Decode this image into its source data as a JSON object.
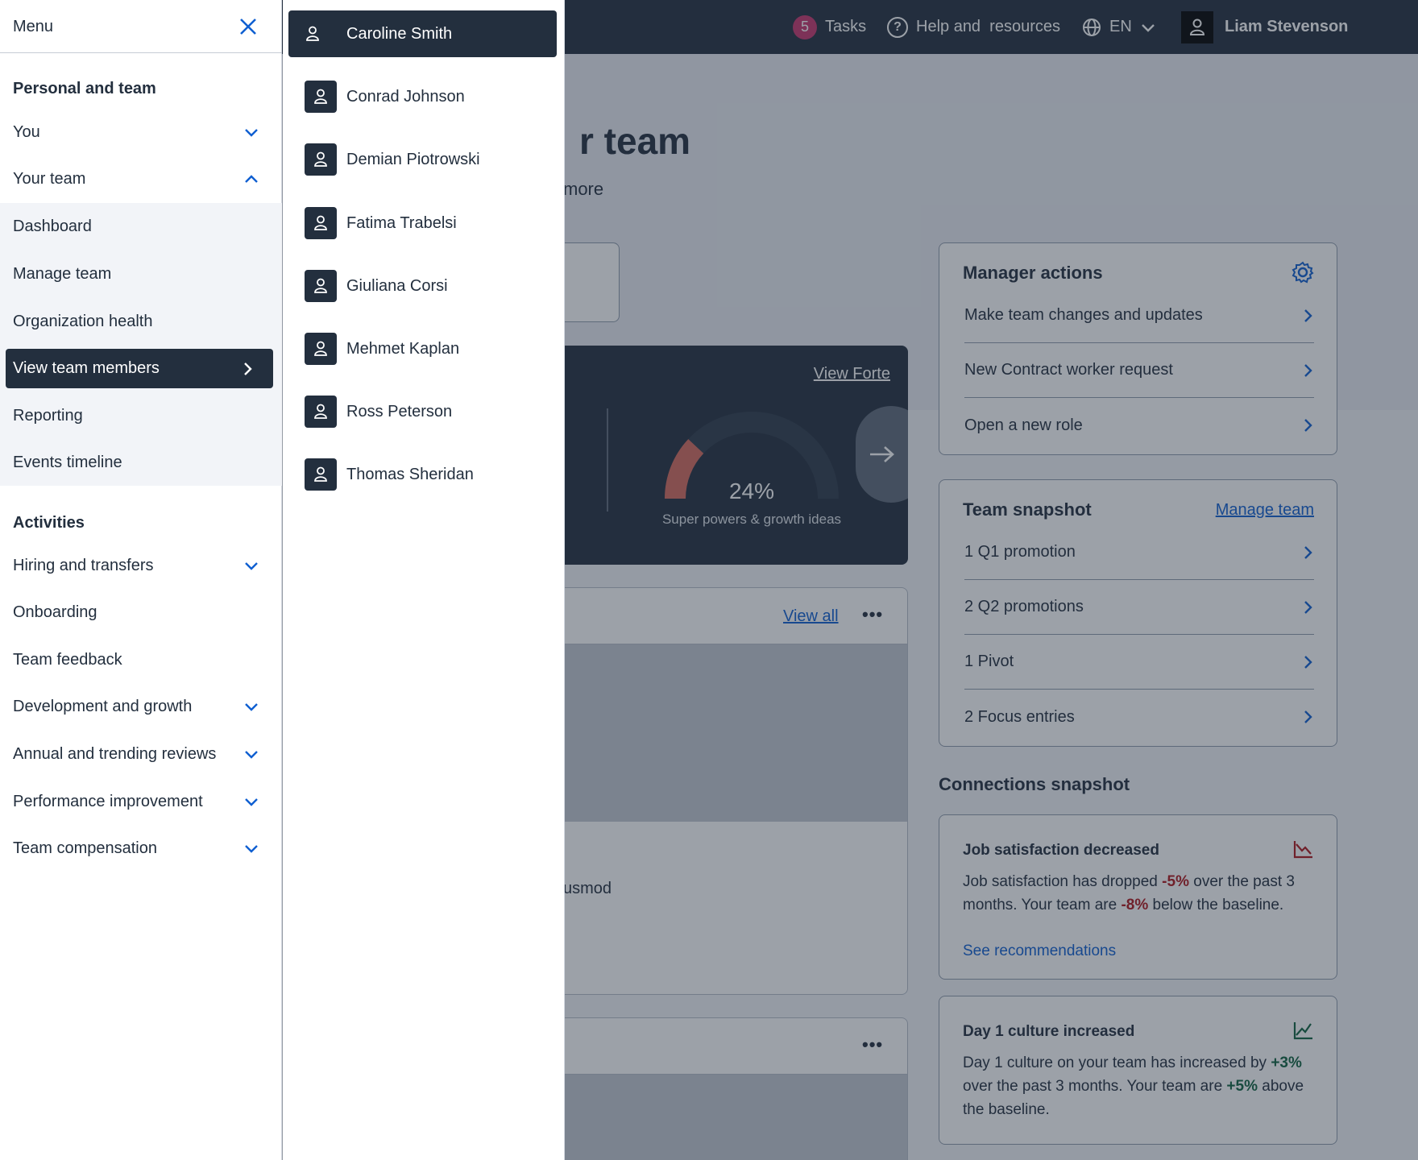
{
  "topbar": {
    "tasks_count": "5",
    "tasks_label": "Tasks",
    "help_label": "Help and  resources",
    "language": "EN",
    "user_name": "Liam Stevenson"
  },
  "page": {
    "title_fragment": "r team",
    "subtitle_fragment": "more",
    "dark_card": {
      "link": "View Forte",
      "gauge_percent": 24,
      "gauge_value": "24%",
      "gauge_label": "Super powers & growth ideas"
    },
    "list_card": {
      "view_all": "View all",
      "more": "•••",
      "text_fragment": "usmod"
    },
    "list_card2": {
      "more": "•••"
    },
    "manager_actions": {
      "title": "Manager actions",
      "items": [
        "Make team changes and updates",
        "New Contract worker request",
        "Open a new role"
      ]
    },
    "team_snapshot": {
      "title": "Team snapshot",
      "link": "Manage team",
      "items": [
        "1 Q1 promotion",
        "2 Q2 promotions",
        "1 Pivot",
        "2 Focus entries"
      ]
    },
    "connections": {
      "title": "Connections snapshot",
      "card1": {
        "title": "Job satisfaction decreased",
        "t1": "Job satisfaction has dropped ",
        "v1": "-5%",
        "t2": " over the past 3 months. Your team are ",
        "v2": "-8%",
        "t3": " below the baseline.",
        "link": "See recommendations"
      },
      "card2": {
        "title": "Day 1 culture increased",
        "t1": "Day 1 culture on your team has increased by ",
        "v1": "+3%",
        "t2": " over the past 3 months. Your team are ",
        "v2": "+5%",
        "t3": " above the baseline."
      }
    }
  },
  "menu": {
    "title": "Menu",
    "section1": "Personal and team",
    "you": "You",
    "your_team": "Your team",
    "team_items": [
      "Dashboard",
      "Manage team",
      "Organization health",
      "View team members",
      "Reporting",
      "Events timeline"
    ],
    "section2": "Activities",
    "activities": [
      "Hiring and transfers",
      "Onboarding",
      "Team feedback",
      "Development and growth",
      "Annual and trending reviews",
      "Performance improvement",
      "Team compensation"
    ]
  },
  "members": [
    "Caroline Smith",
    "Conrad Johnson",
    "Demian Piotrowski",
    "Fatima Trabelsi",
    "Giuliana Corsi",
    "Mehmet Kaplan",
    "Ross Peterson",
    "Thomas Sheridan"
  ],
  "colors": {
    "navy": "#232f3e",
    "link": "#0f5fd1",
    "negative": "#b0161d",
    "positive": "#106341",
    "badge": "#c7356d",
    "gauge_fill": "#d66a5e"
  }
}
